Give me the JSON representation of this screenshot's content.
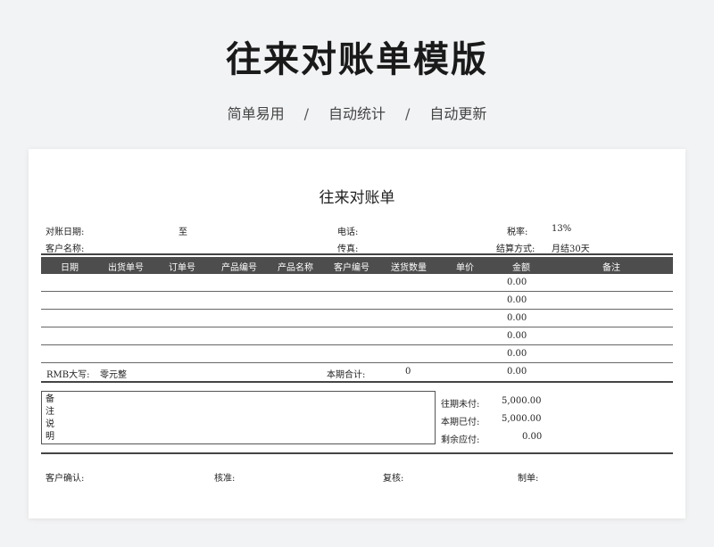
{
  "hero": {
    "title": "往来对账单模版",
    "features": [
      "简单易用",
      "自动统计",
      "自动更新"
    ],
    "separator": "/"
  },
  "doc": {
    "title": "往来对账单",
    "info": {
      "date_label": "对账日期:",
      "date_to": "至",
      "phone_label": "电话:",
      "tax_label": "税率:",
      "tax_value": "13%",
      "customer_label": "客户名称:",
      "fax_label": "传真:",
      "settle_label": "结算方式:",
      "settle_value": "月结30天"
    },
    "columns": [
      "日期",
      "出货单号",
      "订单号",
      "产品编号",
      "产品名称",
      "客户编号",
      "送货数量",
      "单价",
      "金额",
      "备注"
    ],
    "rows": [
      {
        "amount": "0.00"
      },
      {
        "amount": "0.00"
      },
      {
        "amount": "0.00"
      },
      {
        "amount": "0.00"
      },
      {
        "amount": "0.00"
      }
    ],
    "total": {
      "rmb_label": "RMB大写:",
      "rmb_value": "零元整",
      "period_label": "本期合计:",
      "qty": "0",
      "amount": "0.00"
    },
    "notes_label": "备注说明",
    "summary": [
      {
        "label": "往期未付:",
        "value": "5,000.00"
      },
      {
        "label": "本期已付:",
        "value": "5,000.00"
      },
      {
        "label": "剩余应付:",
        "value": "0.00"
      }
    ],
    "signatures": [
      "客户确认:",
      "核准:",
      "复核:",
      "制单:"
    ]
  }
}
